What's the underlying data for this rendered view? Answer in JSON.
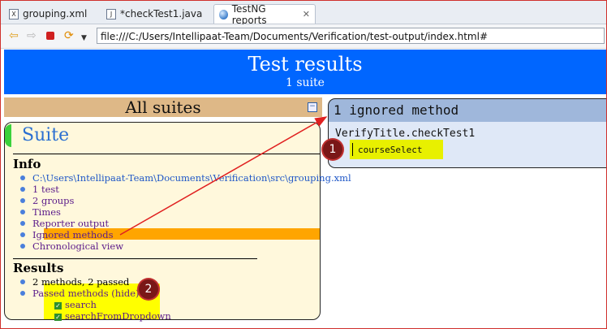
{
  "tabs": [
    {
      "label": "grouping.xml",
      "icon": "xml-file-icon"
    },
    {
      "label": "*checkTest1.java",
      "icon": "java-file-icon"
    },
    {
      "label": "TestNG reports",
      "icon": "globe-icon",
      "active": true
    }
  ],
  "toolbar": {
    "url": "file:///C:/Users/Intellipaat-Team/Documents/Verification/test-output/index.html#"
  },
  "header": {
    "title": "Test results",
    "subtitle": "1 suite"
  },
  "sidebar": {
    "all_suites_label": "All suites",
    "collapse_symbol": "−",
    "suite_name": "Suite",
    "info_heading": "Info",
    "info_items": [
      "C:\\Users\\Intellipaat-Team\\Documents\\Verification\\src\\grouping.xml",
      "1 test",
      "2 groups",
      "Times",
      "Reporter output",
      "Ignored methods",
      "Chronological view"
    ],
    "results_heading": "Results",
    "results_summary": "2 methods, 2 passed",
    "passed_label": "Passed methods",
    "hide_label": "(hide)",
    "passed_methods": [
      "search",
      "searchFromDropdown"
    ]
  },
  "ignored": {
    "heading": "1 ignored method",
    "class_name": "VerifyTitle.checkTest1",
    "method": "courseSelect"
  },
  "annotations": {
    "badge1": "1",
    "badge2": "2",
    "arrow_color": "#e02020"
  },
  "colors": {
    "header_blue": "#0066ff",
    "suites_bar": "#deb887",
    "panel_bg": "#fff8dc",
    "highlight_orange": "#ffa500",
    "highlight_yellow": "#ffff00",
    "ignored_head": "#9fb7db"
  }
}
